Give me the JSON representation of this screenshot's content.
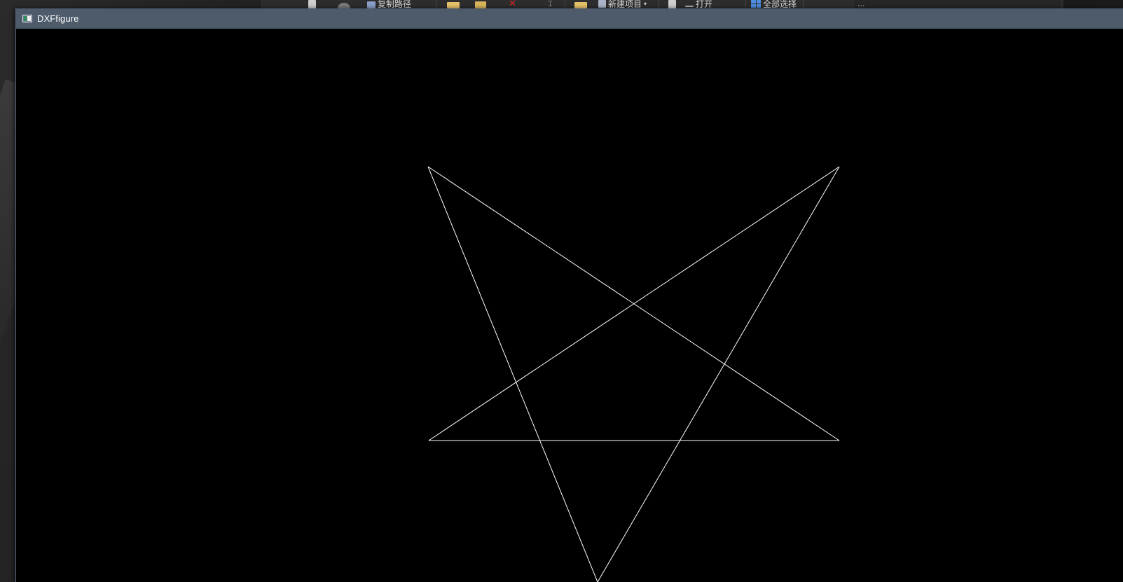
{
  "window": {
    "title": "DXFfigure",
    "titlebar_color": "#4d5b6b",
    "canvas_background": "#000000"
  },
  "background_explorer": {
    "ribbon_items": [
      {
        "label": "复制路径",
        "icon": "copy-path-icon"
      },
      {
        "label": "新建项目",
        "icon": "new-item-icon"
      },
      {
        "label": "打开",
        "icon": "open-icon"
      },
      {
        "label": "全部选择",
        "icon": "select-all-icon"
      }
    ],
    "right_strip_text": "..."
  },
  "drawing": {
    "shape": "pentagram",
    "stroke_color": "#ffffff",
    "lines": [
      {
        "from": "top-left-point",
        "to": "right-point"
      },
      {
        "from": "right-point",
        "to": "left-point"
      },
      {
        "from": "left-point",
        "to": "top-right-point"
      },
      {
        "from": "top-right-point",
        "to": "bottom-point"
      },
      {
        "from": "bottom-point",
        "to": "top-left-point"
      }
    ]
  }
}
